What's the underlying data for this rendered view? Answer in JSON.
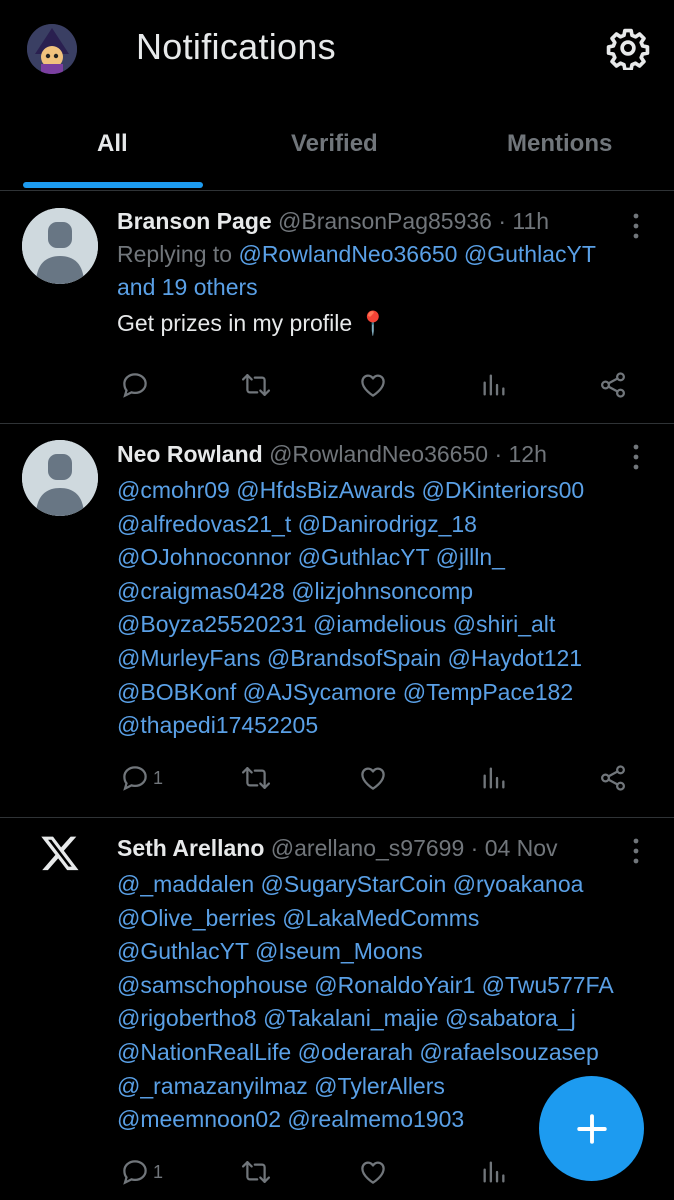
{
  "header": {
    "title": "Notifications"
  },
  "tabs": [
    {
      "label": "All",
      "active": true
    },
    {
      "label": "Verified",
      "active": false
    },
    {
      "label": "Mentions",
      "active": false
    }
  ],
  "posts": [
    {
      "name": "Branson Page",
      "handle": "@BransonPag85936",
      "sep": "·",
      "time": "11h",
      "reply_prefix": "Replying to",
      "reply_mention_1": "@RowlandNeo36650",
      "reply_mention_2": "@GuthlacYT",
      "reply_others": "and 19 others",
      "text": "Get prizes in my profile 📍",
      "reply_count": ""
    },
    {
      "name": "Neo Rowland",
      "handle": "@RowlandNeo36650",
      "sep": "·",
      "time": "12h",
      "lines": [
        "@cmohr09 @HfdsBizAwards @DKinteriors00",
        "@alfredovas21_t @Danirodrigz_18",
        "@OJohnoconnor @GuthlacYT @jllln_",
        "@craigmas0428 @lizjohnsoncomp",
        "@Boyza25520231 @iamdelious @shiri_alt",
        "@MurleyFans @BrandsofSpain @Haydot121",
        "@BOBKonf @AJSycamore @TempPace182",
        "@thapedi17452205"
      ],
      "reply_count": "1"
    },
    {
      "name": "Seth Arellano",
      "handle": "@arellano_s97699",
      "sep": "·",
      "time": "04 Nov",
      "lines": [
        "@_maddalen @SugaryStarCoin @ryoakanoa",
        "@Olive_berries @LakaMedComms",
        "@GuthlacYT @Iseum_Moons",
        "@samschophouse @RonaldoYair1 @Twu577FA",
        "@rigobertho8 @Takalani_majie @sabatora_j",
        "@NationRealLife @oderarah @rafaelsouzasep",
        "@_ramazanyilmaz @TylerAllers",
        "@meemnoon02 @realmemo1903"
      ],
      "reply_count": "1"
    }
  ],
  "colors": {
    "accent": "#1d9bf0",
    "mention": "#5aa0e6",
    "muted": "#71767b",
    "background": "#000000"
  },
  "icons": [
    "gear-icon",
    "more-icon",
    "reply-icon",
    "retweet-icon",
    "like-icon",
    "views-icon",
    "share-icon",
    "plus-icon",
    "x-logo-icon"
  ]
}
